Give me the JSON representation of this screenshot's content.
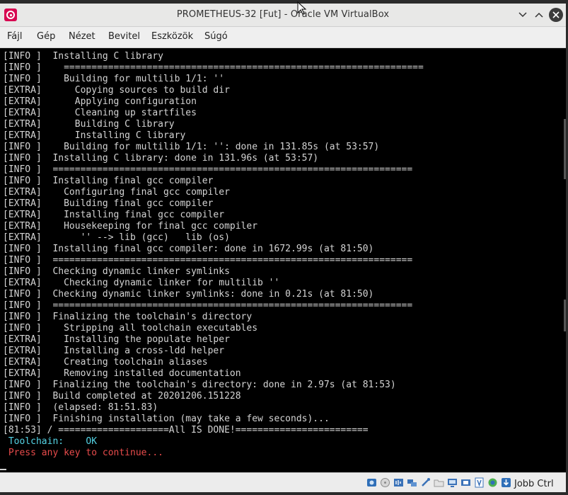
{
  "window": {
    "title": "PROMETHEUS-32 [Fut] - Oracle VM VirtualBox",
    "app_icon": "debian-swirl-icon",
    "controls": [
      "minimize-icon",
      "maximize-icon",
      "close-icon"
    ]
  },
  "menubar": {
    "items": [
      "Fájl",
      "Gép",
      "Nézet",
      "Bevitel",
      "Eszközök",
      "Súgó"
    ]
  },
  "terminal": {
    "lines": [
      "[INFO ]  Installing C library",
      "[INFO ]    =================================================================",
      "[INFO ]    Building for multilib 1/1: ''",
      "[EXTRA]      Copying sources to build dir",
      "[EXTRA]      Applying configuration",
      "[EXTRA]      Cleaning up startfiles",
      "[EXTRA]      Building C library",
      "[EXTRA]      Installing C library",
      "[INFO ]    Building for multilib 1/1: '': done in 131.85s (at 53:57)",
      "[INFO ]  Installing C library: done in 131.96s (at 53:57)",
      "[INFO ]  =================================================================",
      "[INFO ]  Installing final gcc compiler",
      "[EXTRA]    Configuring final gcc compiler",
      "[EXTRA]    Building final gcc compiler",
      "[EXTRA]    Installing final gcc compiler",
      "[EXTRA]    Housekeeping for final gcc compiler",
      "[EXTRA]       '' --> lib (gcc)   lib (os)",
      "[INFO ]  Installing final gcc compiler: done in 1672.99s (at 81:50)",
      "[INFO ]  =================================================================",
      "[INFO ]  Checking dynamic linker symlinks",
      "[EXTRA]    Checking dynamic linker for multilib ''",
      "[INFO ]  Checking dynamic linker symlinks: done in 0.21s (at 81:50)",
      "[INFO ]  =================================================================",
      "[INFO ]  Finalizing the toolchain's directory",
      "[INFO ]    Stripping all toolchain executables",
      "[EXTRA]    Installing the populate helper",
      "[EXTRA]    Installing a cross-ldd helper",
      "[EXTRA]    Creating toolchain aliases",
      "[EXTRA]    Removing installed documentation",
      "[INFO ]  Finalizing the toolchain's directory: done in 2.97s (at 81:53)",
      "[INFO ]  Build completed at 20201206.151228",
      "[INFO ]  (elapsed: 81:51.83)",
      "[INFO ]  Finishing installation (may take a few seconds)...",
      "[81:53] / ====================All IS DONE!========================"
    ],
    "toolchain_status": " Toolchain:    OK",
    "continue_prompt": " Press any key to continue...",
    "colors": {
      "text": "#d4d4d4",
      "ok": "#55d4e6",
      "prompt": "#e84b4b"
    }
  },
  "statusbar": {
    "icons": [
      "hard-disk-icon",
      "optical-disk-icon",
      "audio-icon",
      "network-icon",
      "usb-icon",
      "shared-folders-icon",
      "display-icon",
      "video-capture-icon",
      "recording-icon",
      "cpu-icon",
      "mouse-integration-icon",
      "keyboard-capture-icon"
    ],
    "host_key": "Jobb Ctrl"
  }
}
